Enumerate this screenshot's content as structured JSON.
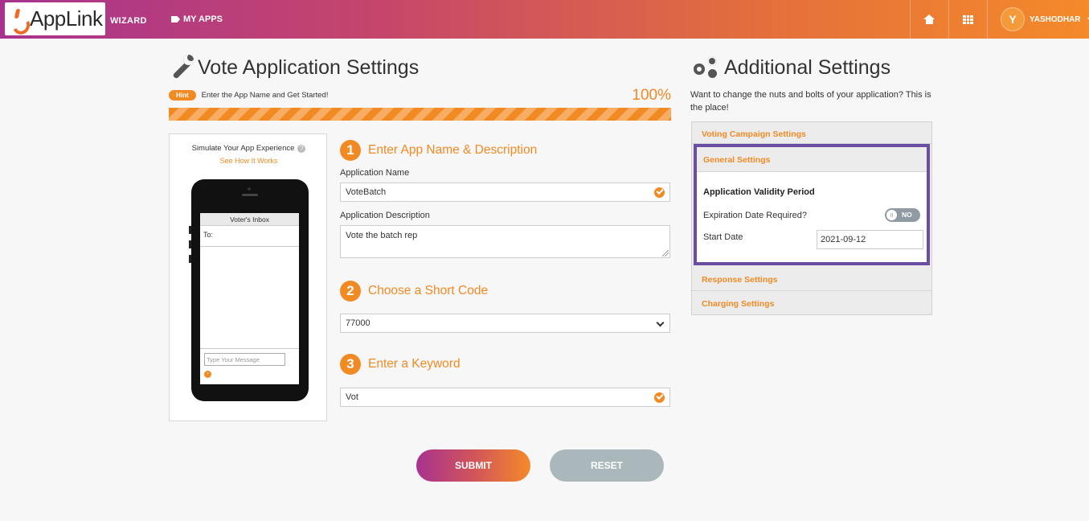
{
  "header": {
    "logo_text": "AppLink",
    "wizard_label": "WIZARD",
    "my_apps_label": "MY APPS",
    "user_initial": "Y",
    "user_name": "YASHODHAR"
  },
  "main": {
    "title": "Vote Application Settings",
    "hint_badge": "Hint",
    "hint_text": "Enter the App Name and Get Started!",
    "progress_text": "100%",
    "progress_value": 1.0
  },
  "simulator": {
    "title": "Simulate Your App Experience",
    "help_glyph": "?",
    "link": "See How It Works",
    "inbox_title": "Voter's Inbox",
    "to_label": "To:",
    "message_placeholder": "Type Your Message",
    "send_glyph": "›"
  },
  "steps": [
    {
      "number": "1",
      "title": "Enter App Name & Description"
    },
    {
      "number": "2",
      "title": "Choose a Short Code"
    },
    {
      "number": "3",
      "title": "Enter a Keyword"
    }
  ],
  "form": {
    "app_name_label": "Application Name",
    "app_name_value": "VoteBatch",
    "app_desc_label": "Application Description",
    "app_desc_value": "Vote the batch rep",
    "short_code_value": "77000",
    "keyword_value": "Vot"
  },
  "buttons": {
    "submit": "SUBMIT",
    "reset": "RESET"
  },
  "additional": {
    "title": "Additional Settings",
    "description": "Want to change the nuts and bolts of your application? This is the place!",
    "sections": {
      "voting": "Voting Campaign Settings",
      "general": "General Settings",
      "response": "Response Settings",
      "charging": "Charging Settings"
    },
    "validity_heading": "Application Validity Period",
    "expiration_label": "Expiration Date Required?",
    "expiration_toggle": "NO",
    "start_date_label": "Start Date",
    "start_date_value": "2021-09-12"
  },
  "colors": {
    "accent": "#f28a24",
    "highlight_border": "#6a4ea3",
    "header_gradient_start": "#a8338f",
    "header_gradient_end": "#f48a2a"
  }
}
